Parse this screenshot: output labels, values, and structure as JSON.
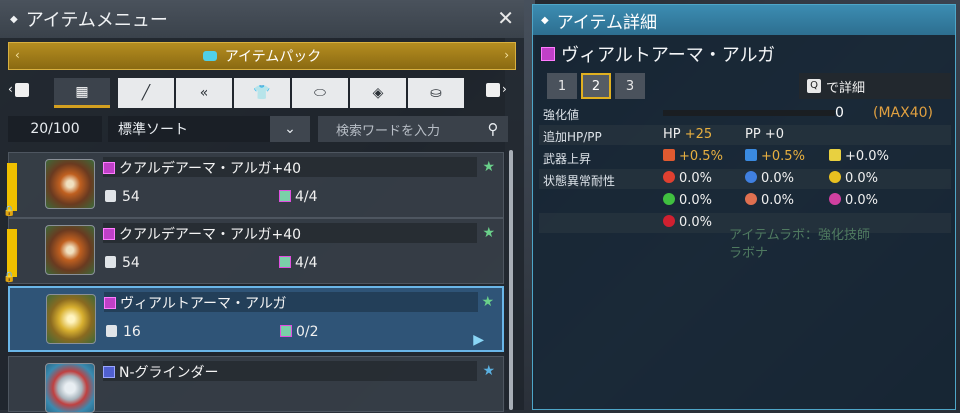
{
  "left_panel": {
    "title": "アイテムメニュー",
    "close_glyph": "✕",
    "pack_label": "アイテムパック",
    "tabs": [
      {
        "icon": "grid-icon",
        "glyph": "▦"
      },
      {
        "icon": "sword-icon",
        "glyph": "╱"
      },
      {
        "icon": "double-chevron-icon",
        "glyph": "«"
      },
      {
        "icon": "shirt-icon",
        "glyph": "👕"
      },
      {
        "icon": "tag-icon",
        "glyph": "⬭"
      },
      {
        "icon": "gem-icon",
        "glyph": "◈"
      },
      {
        "icon": "person-icon",
        "glyph": "⛀"
      }
    ],
    "count": "20/100",
    "sort_label": "標準ソート",
    "search_placeholder": "検索ワードを入力",
    "items": [
      {
        "name": "クアルデアーマ・アルガ+40",
        "defense": "54",
        "slots": "4/4",
        "locked": true,
        "selected": false,
        "thumb": "orange-armor"
      },
      {
        "name": "クアルデアーマ・アルガ+40",
        "defense": "54",
        "slots": "4/4",
        "locked": true,
        "selected": false,
        "thumb": "orange-armor"
      },
      {
        "name": "ヴィアルトアーマ・アルガ",
        "defense": "16",
        "slots": "0/2",
        "locked": false,
        "selected": true,
        "thumb": "gold-armor"
      },
      {
        "name": "N-グラインダー",
        "defense": "",
        "slots": "",
        "locked": false,
        "selected": false,
        "thumb": "grinder"
      }
    ]
  },
  "right_panel": {
    "title": "アイテム詳細",
    "item_name": "ヴィアルトアーマ・アルガ",
    "pages": [
      "1",
      "2",
      "3"
    ],
    "selected_page": "2",
    "detail_key": "Q",
    "detail_label": "で詳細",
    "enhance_label": "強化値",
    "enhance_value": "0",
    "enhance_max": "(MAX40)",
    "hp_pp_label": "追加HP/PP",
    "hp_label": "HP",
    "hp_value": "+25",
    "pp_label": "PP",
    "pp_value": "+0",
    "weapon_label": "武器上昇",
    "weapon_values": [
      "+0.5%",
      "+0.5%",
      "+0.0%"
    ],
    "status_label": "状態異常耐性",
    "status_values": [
      "0.0%",
      "0.0%",
      "0.0%",
      "0.0%",
      "0.0%",
      "0.0%",
      "0.0%"
    ],
    "watermark_line1": "アイテムラボ：強化技師",
    "watermark_line2": "ラボナ"
  },
  "colors": {
    "accent_gold": "#d4a020",
    "accent_blue": "#4ea6c8",
    "value_orange": "#e8b040"
  }
}
